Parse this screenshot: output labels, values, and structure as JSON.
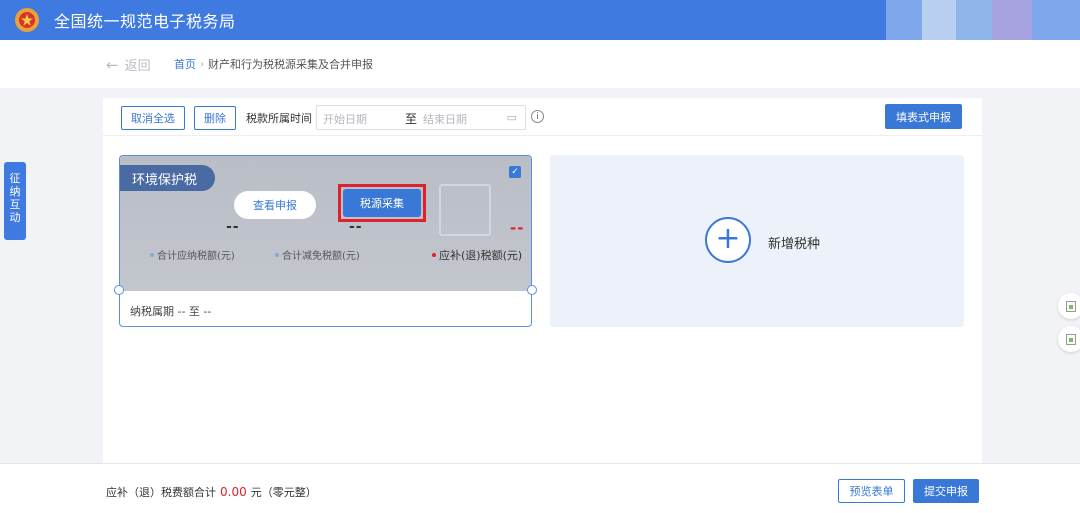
{
  "app": {
    "title": "全国统一规范电子税务局"
  },
  "header": {
    "back_label": "返回",
    "breadcrumb": {
      "home": "首页",
      "current": "财产和行为税税源采集及合并申报"
    }
  },
  "toolbar": {
    "deselect_all": "取消全选",
    "delete": "删除",
    "period_label": "税款所属时间",
    "date_start_placeholder": "开始日期",
    "date_to": "至",
    "date_end_placeholder": "结束日期",
    "form_declare": "填表式申报"
  },
  "side_tab": {
    "chars": [
      "征",
      "纳",
      "互",
      "动"
    ]
  },
  "tax_card": {
    "name": "环境保护税",
    "checked": true,
    "view_button": "查看申报",
    "collect_button": "税源采集",
    "values": [
      "--",
      "--",
      "--"
    ],
    "metrics": [
      "合计应纳税额(元)",
      "合计减免税额(元)",
      "应补(退)税额(元)"
    ],
    "period": "纳税属期 -- 至 --"
  },
  "add_card": {
    "label": "新增税种"
  },
  "footer": {
    "total_label": "应补（退）税费额合计",
    "total_amount": "0.00",
    "total_unit": "元（零元整）",
    "preview_button": "预览表单",
    "submit_button": "提交申报"
  },
  "colors": {
    "primary": "#3a78d8",
    "topbar": "#3f7ae0",
    "alert_red": "#e0202a"
  },
  "icons": {
    "emblem": "tax-emblem-icon",
    "back": "arrow-left-icon",
    "calendar": "calendar-icon",
    "info": "info-circle-icon",
    "add": "plus-circle-icon",
    "check": "checkbox-icon"
  }
}
